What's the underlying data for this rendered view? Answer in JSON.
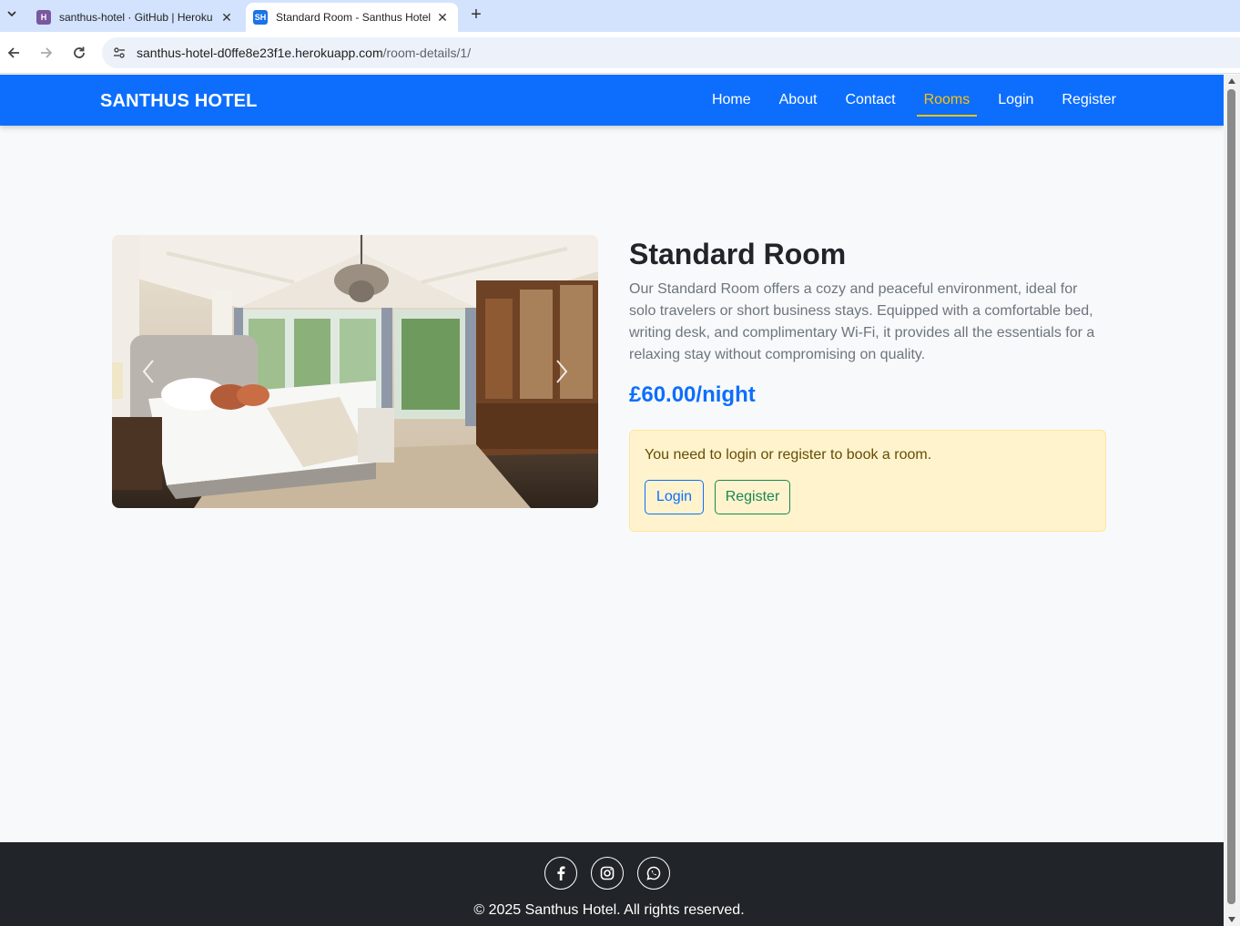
{
  "browser": {
    "tabs": [
      {
        "title": "santhus-hotel · GitHub | Heroku",
        "favicon": "H",
        "active": false
      },
      {
        "title": "Standard Room - Santhus Hotel",
        "favicon": "SH",
        "active": true
      }
    ],
    "url_host": "santhus-hotel-d0ffe8e23f1e.herokuapp.com",
    "url_path": "/room-details/1/"
  },
  "navbar": {
    "brand": "SANTHUS HOTEL",
    "links": [
      "Home",
      "About",
      "Contact",
      "Rooms",
      "Login",
      "Register"
    ],
    "active_link": "Rooms",
    "color": "#0d6efd",
    "active_color": "#ffc107"
  },
  "room": {
    "title": "Standard Room",
    "description": "Our Standard Room offers a cozy and peaceful environment, ideal for solo travelers or short business stays. Equipped with a comfortable bed, writing desk, and complimentary Wi-Fi, it provides all the essentials for a relaxing stay without compromising on quality.",
    "price": "£60.00/night",
    "image_alt": "Standard Room"
  },
  "booking_alert": {
    "message": "You need to login or register to book a room.",
    "login_label": "Login",
    "register_label": "Register"
  },
  "footer": {
    "socials": [
      "facebook-icon",
      "instagram-icon",
      "whatsapp-icon"
    ],
    "copyright": "© 2025 Santhus Hotel. All rights reserved."
  }
}
